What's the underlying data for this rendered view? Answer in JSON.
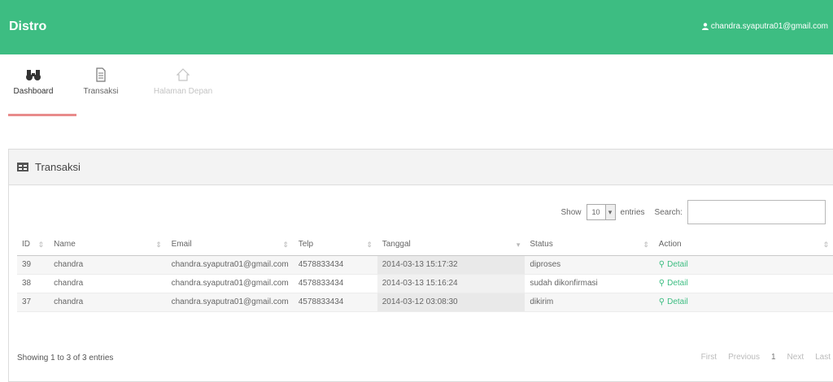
{
  "header": {
    "brand": "Distro",
    "user_email": "chandra.syaputra01@gmail.com"
  },
  "nav": [
    {
      "label": "Dashboard",
      "icon": "binoculars-icon",
      "state": "active"
    },
    {
      "label": "Transaksi",
      "icon": "document-icon",
      "state": "normal"
    },
    {
      "label": "Halaman Depan",
      "icon": "home-icon",
      "state": "disabled"
    }
  ],
  "panel": {
    "title": "Transaksi"
  },
  "table_controls": {
    "show_label": "Show",
    "page_length": "10",
    "entries_label": "entries",
    "search_label": "Search:",
    "search_value": ""
  },
  "table": {
    "columns": [
      "ID",
      "Name",
      "Email",
      "Telp",
      "Tanggal",
      "Status",
      "Action"
    ],
    "rows": [
      {
        "id": "39",
        "name": "chandra",
        "email": "chandra.syaputra01@gmail.com",
        "telp": "4578833434",
        "tanggal": "2014-03-13 15:17:32",
        "status": "diproses",
        "action": "Detail"
      },
      {
        "id": "38",
        "name": "chandra",
        "email": "chandra.syaputra01@gmail.com",
        "telp": "4578833434",
        "tanggal": "2014-03-13 15:16:24",
        "status": "sudah dikonfirmasi",
        "action": "Detail"
      },
      {
        "id": "37",
        "name": "chandra",
        "email": "chandra.syaputra01@gmail.com",
        "telp": "4578833434",
        "tanggal": "2014-03-12 03:08:30",
        "status": "dikirim",
        "action": "Detail"
      }
    ]
  },
  "footer": {
    "info": "Showing 1 to 3 of 3 entries",
    "pagination": [
      "First",
      "Previous",
      "1",
      "Next",
      "Last"
    ]
  },
  "colors": {
    "primary": "#3dbd82",
    "nav_underline": "#e88b8b"
  }
}
